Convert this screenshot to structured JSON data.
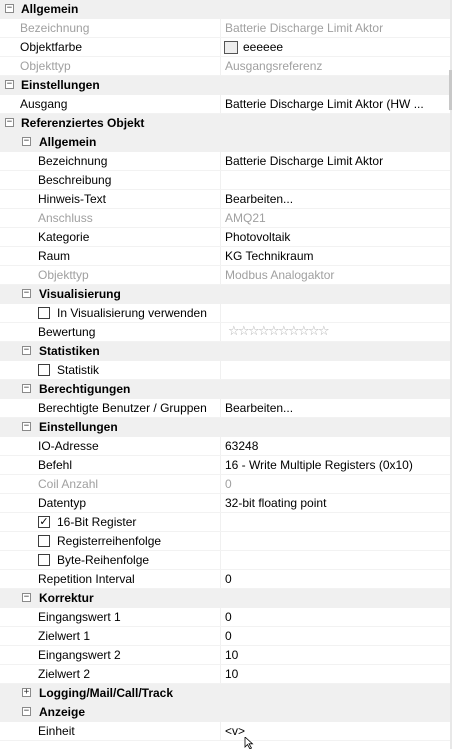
{
  "categories": {
    "allgemein": "Allgemein",
    "einstellungen": "Einstellungen",
    "ref_objekt": "Referenziertes Objekt"
  },
  "allgemein": {
    "bezeichnung": {
      "name": "Bezeichnung",
      "value": "Batterie Discharge Limit Aktor"
    },
    "objektfarbe": {
      "name": "Objektfarbe",
      "value": "eeeeee",
      "color": "#eeeeee"
    },
    "objekttyp": {
      "name": "Objekttyp",
      "value": "Ausgangsreferenz"
    }
  },
  "einstellungen": {
    "ausgang": {
      "name": "Ausgang",
      "value": "Batterie Discharge Limit Aktor (HW ..."
    }
  },
  "ref": {
    "allgemein": {
      "title": "Allgemein",
      "bezeichnung": {
        "name": "Bezeichnung",
        "value": "Batterie Discharge Limit Aktor"
      },
      "beschreibung": {
        "name": "Beschreibung",
        "value": ""
      },
      "hinweis": {
        "name": "Hinweis-Text",
        "value": "Bearbeiten..."
      },
      "anschluss": {
        "name": "Anschluss",
        "value": "AMQ21"
      },
      "kategorie": {
        "name": "Kategorie",
        "value": "Photovoltaik"
      },
      "raum": {
        "name": "Raum",
        "value": "KG Technikraum"
      },
      "objekttyp": {
        "name": "Objekttyp",
        "value": "Modbus Analogaktor"
      }
    },
    "visualisierung": {
      "title": "Visualisierung",
      "in_vis": {
        "label": "In Visualisierung verwenden",
        "checked": false
      },
      "bewertung": {
        "name": "Bewertung",
        "stars_total": 10,
        "stars_filled": 0
      }
    },
    "statistiken": {
      "title": "Statistiken",
      "statistik": {
        "label": "Statistik",
        "checked": false
      }
    },
    "berechtigungen": {
      "title": "Berechtigungen",
      "benutzer": {
        "name": "Berechtigte Benutzer / Gruppen",
        "value": "Bearbeiten..."
      }
    },
    "einstellungen": {
      "title": "Einstellungen",
      "io_adresse": {
        "name": "IO-Adresse",
        "value": "63248"
      },
      "befehl": {
        "name": "Befehl",
        "value": "16 - Write Multiple Registers (0x10)"
      },
      "coil_anzahl": {
        "name": "Coil Anzahl",
        "value": "0"
      },
      "datentyp": {
        "name": "Datentyp",
        "value": "32-bit floating point"
      },
      "bit16": {
        "label": "16-Bit Register",
        "checked": true
      },
      "reg_reihenfolge": {
        "label": "Registerreihenfolge",
        "checked": false
      },
      "byte_reihenfolge": {
        "label": "Byte-Reihenfolge",
        "checked": false
      },
      "repetition": {
        "name": "Repetition Interval",
        "value": "0"
      }
    },
    "korrektur": {
      "title": "Korrektur",
      "eingang1": {
        "name": "Eingangswert 1",
        "value": "0"
      },
      "ziel1": {
        "name": "Zielwert 1",
        "value": "0"
      },
      "eingang2": {
        "name": "Eingangswert 2",
        "value": "10"
      },
      "ziel2": {
        "name": "Zielwert 2",
        "value": "10"
      }
    },
    "logging": {
      "title": "Logging/Mail/Call/Track"
    },
    "anzeige": {
      "title": "Anzeige",
      "einheit": {
        "name": "Einheit",
        "value": "<v>"
      }
    }
  },
  "icons": {
    "collapse": "−",
    "expand": "+",
    "check": "✓",
    "star": "☆"
  },
  "colors": {
    "disabled_text": "#a0a0a0",
    "category_bg": "#f0f0f0"
  }
}
